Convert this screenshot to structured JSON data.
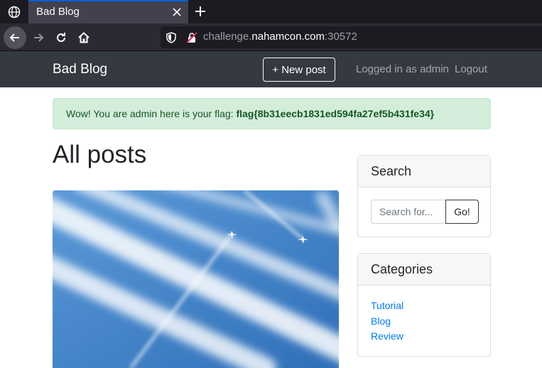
{
  "browser": {
    "tab_title": "Bad Blog",
    "url_prefix": "challenge.",
    "url_host": "nahamcon.com",
    "url_port": ":30572"
  },
  "navbar": {
    "brand": "Bad Blog",
    "new_post_label": "+ New post",
    "logged_in_text": "Logged in as admin",
    "logout_label": "Logout"
  },
  "alert": {
    "message": "Wow! You are admin here is your flag: ",
    "flag": "flag{8b31eecb1831ed594fa27ef5b431fe34}"
  },
  "main": {
    "heading": "All posts"
  },
  "sidebar": {
    "search": {
      "title": "Search",
      "placeholder": "Search for...",
      "button_label": "Go!"
    },
    "categories": {
      "title": "Categories",
      "items": [
        "Tutorial",
        "Blog",
        "Review"
      ]
    }
  },
  "colors": {
    "navbar_bg": "#343a40",
    "alert_bg": "#d4edda",
    "alert_text": "#155724",
    "link": "#007bff"
  }
}
